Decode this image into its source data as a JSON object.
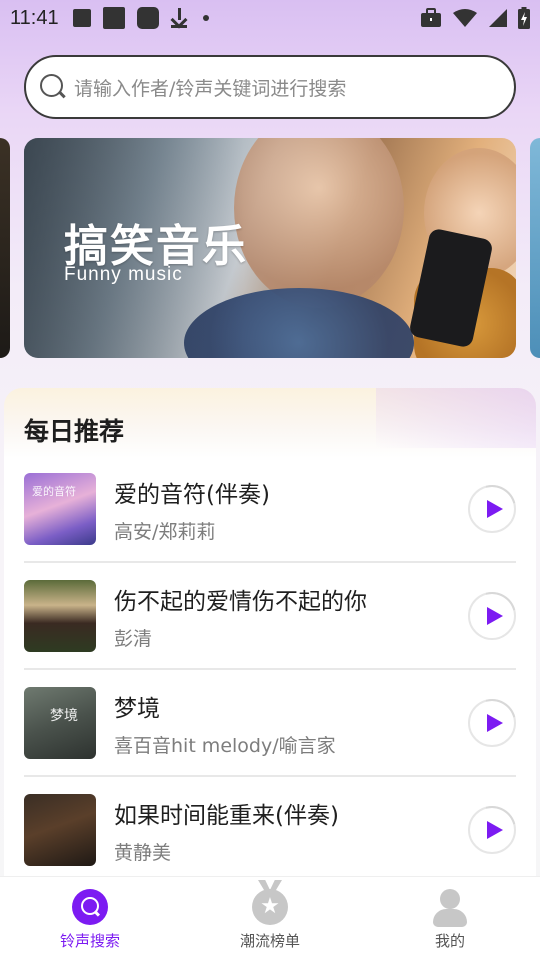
{
  "status_bar": {
    "time": "11:41",
    "icons": [
      "image-icon",
      "square-icon",
      "rounded-square-icon",
      "download-icon",
      "dot-icon",
      "briefcase-icon",
      "wifi-icon",
      "signal-icon",
      "battery-charging-icon"
    ]
  },
  "search": {
    "placeholder": "请输入作者/铃声关键词进行搜索"
  },
  "banner": {
    "title": "搞笑音乐",
    "subtitle": "Funny music"
  },
  "daily": {
    "title": "每日推荐",
    "songs": [
      {
        "title": "爱的音符(伴奏)",
        "artist": "高安/郑莉莉"
      },
      {
        "title": "伤不起的爱情伤不起的你",
        "artist": "彭清"
      },
      {
        "title": "梦境",
        "artist": "喜百音hit melody/喻言家"
      },
      {
        "title": "如果时间能重来(伴奏)",
        "artist": "黄静美"
      }
    ]
  },
  "bottom_nav": {
    "items": [
      {
        "label": "铃声搜索",
        "icon": "search-icon",
        "active": true
      },
      {
        "label": "潮流榜单",
        "icon": "trophy-icon",
        "active": false
      },
      {
        "label": "我的",
        "icon": "person-icon",
        "active": false
      }
    ]
  },
  "colors": {
    "accent": "#7c1bf2",
    "inactive": "#c7c7c7",
    "text_primary": "#1f1f1f",
    "text_secondary": "#7d7d7d"
  }
}
